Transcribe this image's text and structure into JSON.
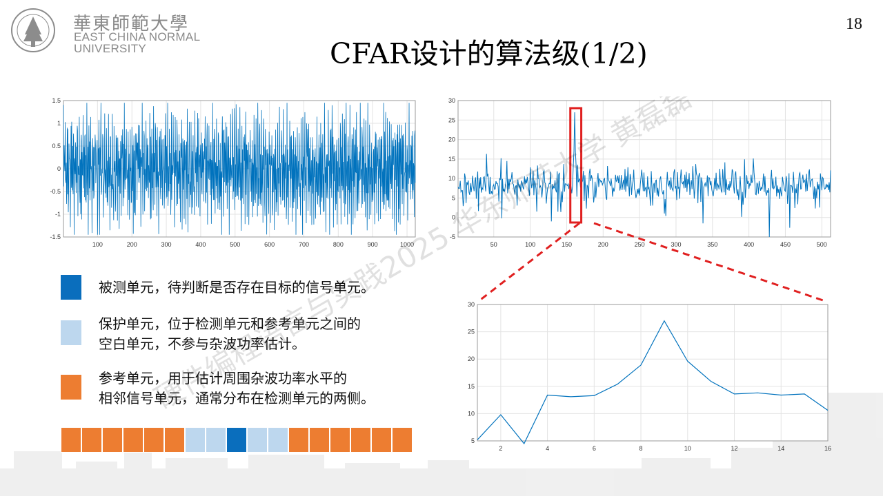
{
  "logo": {
    "cn": "華東師範大學",
    "en_line1": "EAST CHINA NORMAL",
    "en_line2": "UNIVERSITY",
    "seal_text": "EAST CHINA NORMAL UNIVERSITY · 华东师范大学"
  },
  "page_number": "18",
  "title": "CFAR设计的算法级(1/2)",
  "colors": {
    "cut": "#0A6EBD",
    "guard": "#BDD7EE",
    "reference": "#ED7D31",
    "line": "#0072BD",
    "highlight": "#E02020"
  },
  "legend": [
    {
      "id": "cut",
      "color": "#0A6EBD",
      "lines": [
        "被测单元，待判断是否存在目标的信号单元。"
      ]
    },
    {
      "id": "guard",
      "color": "#BDD7EE",
      "lines": [
        "保护单元，位于检测单元和参考单元之间的",
        "空白单元，不参与杂波功率估计。"
      ]
    },
    {
      "id": "reference",
      "color": "#ED7D31",
      "lines": [
        "参考单元，用于估计周围杂波功率水平的",
        "相邻信号单元，通常分布在检测单元的两侧。"
      ]
    }
  ],
  "cell_strip": [
    "reference",
    "reference",
    "reference",
    "reference",
    "reference",
    "reference",
    "guard",
    "guard",
    "cut",
    "guard",
    "guard",
    "reference",
    "reference",
    "reference",
    "reference",
    "reference",
    "reference"
  ],
  "watermark": "硬件编程语言与实践2025 华东师范大学 黄磊磊",
  "chart_data": [
    {
      "type": "line",
      "name": "time-signal",
      "xlim": [
        1,
        1024
      ],
      "ylim": [
        -1.5,
        1.5
      ],
      "xticks": [
        100,
        200,
        300,
        400,
        500,
        600,
        700,
        800,
        900,
        1000
      ],
      "yticks": [
        -1.5,
        -1,
        -0.5,
        0,
        0.5,
        1,
        1.5
      ],
      "yticklabels": [
        "-1.5",
        "-1",
        "-0.5",
        "0",
        "0.5",
        "1",
        "1.5"
      ],
      "grid": true,
      "n_points": 1024,
      "seed": 7
    },
    {
      "type": "line",
      "name": "spectrum-db",
      "xlim": [
        1,
        512
      ],
      "ylim": [
        -5,
        30
      ],
      "xticks": [
        50,
        100,
        150,
        200,
        250,
        300,
        350,
        400,
        450,
        500
      ],
      "yticks": [
        -5,
        0,
        5,
        10,
        15,
        20,
        25,
        30
      ],
      "grid": true,
      "n_points": 512,
      "seed": 11,
      "peak_x": 161,
      "peak_y": 27,
      "highlight_x": [
        155,
        170
      ]
    },
    {
      "type": "line",
      "name": "zoom",
      "xlim": [
        1,
        16
      ],
      "ylim": [
        5,
        30
      ],
      "xticks": [
        2,
        4,
        6,
        8,
        10,
        12,
        14,
        16
      ],
      "yticks": [
        5,
        10,
        15,
        20,
        25,
        30
      ],
      "grid": true,
      "x": [
        1,
        2,
        3,
        4,
        5,
        6,
        7,
        8,
        9,
        10,
        11,
        12,
        13,
        14,
        15,
        16
      ],
      "y": [
        5.2,
        9.8,
        4.5,
        13.4,
        13.1,
        13.3,
        15.4,
        18.9,
        27.0,
        19.6,
        15.9,
        13.6,
        13.8,
        13.4,
        13.6,
        10.6
      ]
    }
  ]
}
